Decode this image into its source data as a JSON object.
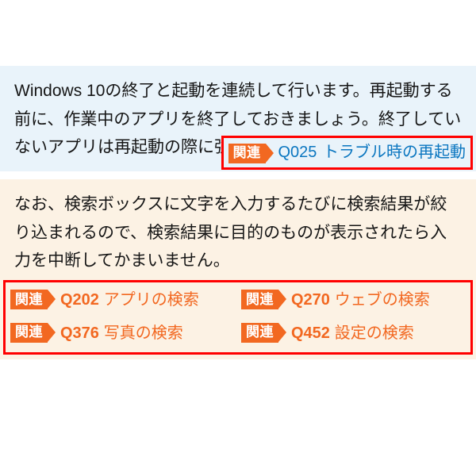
{
  "blue": {
    "paragraph": "Windows 10の終了と起動を連続して行います。再起動する前に、作業中のアプリを終了しておきましょう。終了していないアプリは再起動の際に強制的に閉じられます。",
    "related": {
      "tag": "関連",
      "code": "Q025",
      "title": "トラブル時の再起動"
    }
  },
  "cream": {
    "paragraph": "なお、検索ボックスに文字を入力するたびに検索結果が絞り込まれるので、検索結果に目的のものが表示されたら入力を中断してかまいません。",
    "related_tag": "関連",
    "items": [
      {
        "code": "Q202",
        "title": "アプリの検索"
      },
      {
        "code": "Q270",
        "title": "ウェブの検索"
      },
      {
        "code": "Q376",
        "title": "写真の検索"
      },
      {
        "code": "Q452",
        "title": "設定の検索"
      }
    ]
  }
}
